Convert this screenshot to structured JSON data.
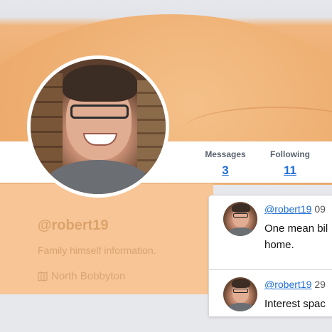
{
  "profile": {
    "handle": "@robert19",
    "bio": "Family himself information.",
    "location": "North Bobbyton"
  },
  "stats": {
    "messages_label": "Messages",
    "messages_count": "3",
    "following_label": "Following",
    "following_count": "11"
  },
  "feed": {
    "tweets": [
      {
        "user": "@robert19",
        "time": "09",
        "text_line1": "One mean bil",
        "text_line2": "home."
      },
      {
        "user": "@robert19",
        "time": "29",
        "text_line1": "Interest spac"
      }
    ]
  },
  "colors": {
    "link": "#1f6fd6",
    "banner_sand": "#eeaa6b",
    "profile_text": "#dba36b"
  },
  "icons": {
    "location": "map-icon"
  }
}
